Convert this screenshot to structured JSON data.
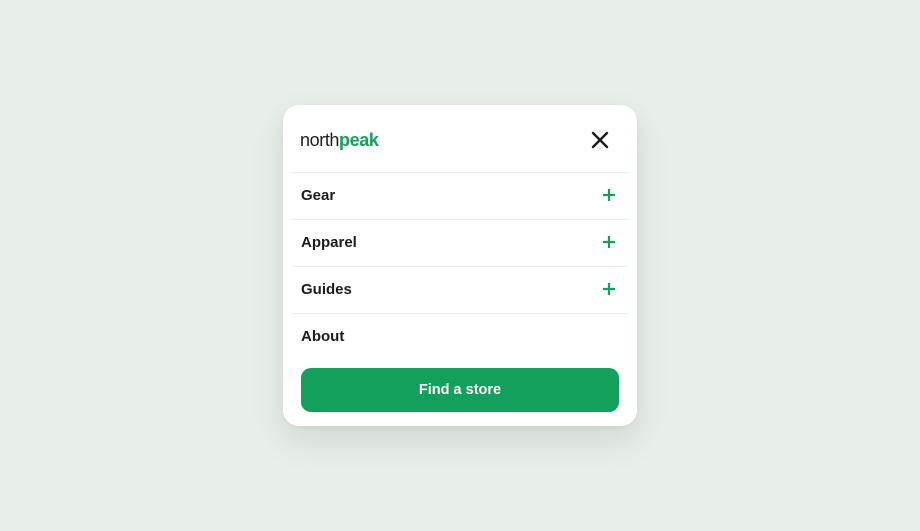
{
  "brand": {
    "name_regular": "north",
    "name_bold": "peak",
    "accent_color": "#12a05c",
    "text_color": "#1b1f1c"
  },
  "menu": {
    "close_icon": "close-icon",
    "items": [
      {
        "label": "Gear",
        "expandable": true,
        "icon": "plus-icon"
      },
      {
        "label": "Apparel",
        "expandable": true,
        "icon": "plus-icon"
      },
      {
        "label": "Guides",
        "expandable": true,
        "icon": "plus-icon"
      },
      {
        "label": "About",
        "expandable": false
      }
    ]
  },
  "cta": {
    "label": "Find a store",
    "background": "#12a05c"
  },
  "colors": {
    "page_background": "#e7efe8",
    "panel_background": "#ffffff",
    "divider": "#e9eeea"
  }
}
